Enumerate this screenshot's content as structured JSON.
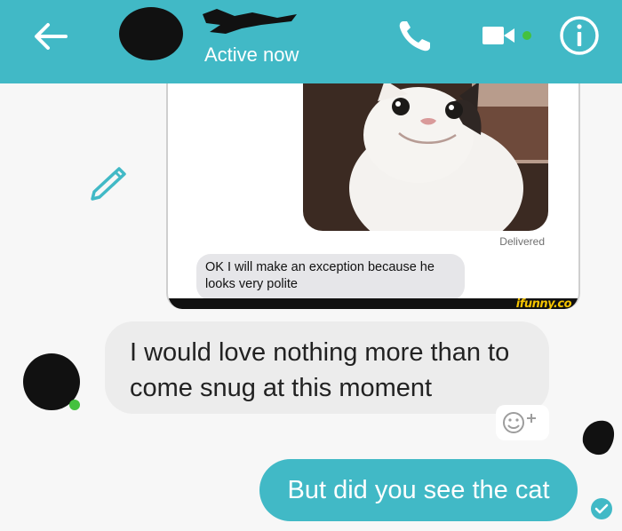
{
  "colors": {
    "accent": "#41b9c6",
    "online": "#44c13f",
    "bubble_in": "#ececec"
  },
  "header": {
    "status": "Active now",
    "icons": [
      "back-arrow-icon",
      "phone-icon",
      "video-camera-icon",
      "info-icon"
    ]
  },
  "embedded_screenshot": {
    "status": "Delivered",
    "message": "OK I will make an exception because he looks very polite",
    "watermark": "ifunny.co"
  },
  "messages": [
    {
      "direction": "incoming",
      "text": "I would love nothing more than to come snug at this moment"
    },
    {
      "direction": "outgoing",
      "text": "But did you see the cat"
    }
  ]
}
